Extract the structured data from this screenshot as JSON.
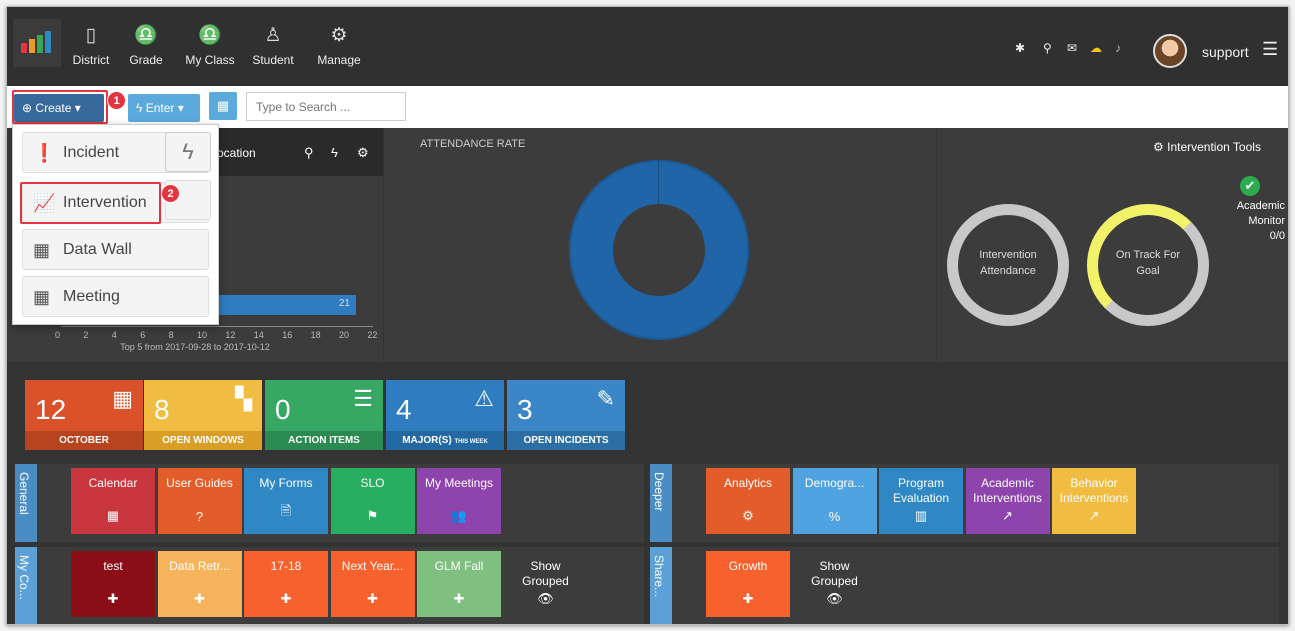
{
  "nav": {
    "items": [
      {
        "label": "District",
        "icon": "building-icon",
        "glyph": "▯"
      },
      {
        "label": "Grade",
        "icon": "users-icon",
        "glyph": "♎"
      },
      {
        "label": "My Class",
        "icon": "users-icon",
        "glyph": "♎"
      },
      {
        "label": "Student",
        "icon": "user-icon",
        "glyph": "♙"
      },
      {
        "label": "Manage",
        "icon": "gears-icon",
        "glyph": "⚙"
      }
    ],
    "user": "support"
  },
  "toolbar": {
    "create_label": "Create",
    "enter_label": "Enter",
    "search_placeholder": "Type to Search ..."
  },
  "dropdown": {
    "items": [
      "Incident",
      "Intervention",
      "Data Wall",
      "Meeting"
    ]
  },
  "callouts": {
    "one": "1",
    "two": "2"
  },
  "widgets": {
    "incidents_header": "ocation",
    "bar_value": "21",
    "x_ticks": [
      "0",
      "2",
      "4",
      "6",
      "8",
      "10",
      "12",
      "14",
      "16",
      "18",
      "20",
      "22"
    ],
    "footnote": "Top 5 from 2017-09-28 to 2017-10-12",
    "attendance_title": "ATTENDANCE RATE",
    "intervention_tools": "Intervention Tools",
    "ring1": "Intervention Attendance",
    "ring2": "On Track For Goal",
    "academic": "Academic Monitor",
    "academic_count": "0/0"
  },
  "tiles": [
    {
      "num": "12",
      "label": "OCTOBER",
      "color": "#d9522a",
      "dark": "#b8431f",
      "icon": "calendar-icon",
      "glyph": "▦"
    },
    {
      "num": "8",
      "label": "OPEN WINDOWS",
      "color": "#f0bc41",
      "dark": "#d99e25",
      "icon": "windows-icon",
      "glyph": "▚"
    },
    {
      "num": "0",
      "label": "ACTION ITEMS",
      "color": "#37a764",
      "dark": "#2a8a4f",
      "icon": "list-icon",
      "glyph": "☰"
    },
    {
      "num": "4",
      "label": "MAJOR(S)",
      "sub": "THIS WEEK",
      "color": "#2f7cc0",
      "dark": "#2468a3",
      "icon": "warning-icon",
      "glyph": "⚠"
    },
    {
      "num": "3",
      "label": "OPEN INCIDENTS",
      "color": "#3a86c6",
      "dark": "#2c6fa6",
      "icon": "pencil-icon",
      "glyph": "✎"
    }
  ],
  "sections": {
    "general": {
      "tab": "General",
      "cards": [
        {
          "label": "Calendar",
          "color": "#c9363e",
          "glyph": "▦",
          "icon": "calendar-icon"
        },
        {
          "label": "User Guides",
          "color": "#e35d2a",
          "glyph": "?",
          "icon": "question-icon"
        },
        {
          "label": "My Forms",
          "color": "#2f87c4",
          "glyph": "🗎",
          "icon": "form-icon"
        },
        {
          "label": "SLO",
          "color": "#27ae60",
          "glyph": "⚑",
          "icon": "flag-icon"
        },
        {
          "label": "My Meetings",
          "color": "#8e44ad",
          "glyph": "👥",
          "icon": "group-icon"
        }
      ]
    },
    "deeper": {
      "tab": "Deeper",
      "cards": [
        {
          "label": "Analytics",
          "color": "#e35d2a",
          "glyph": "⚙",
          "icon": "gears-icon"
        },
        {
          "label": "Demogra...",
          "color": "#4fa3e0",
          "glyph": "%",
          "icon": "percent-icon"
        },
        {
          "label": "Program Evaluation",
          "color": "#2f87c4",
          "glyph": "▥",
          "icon": "chart-icon"
        },
        {
          "label": "Academic Interventions",
          "color": "#8e44ad",
          "glyph": "↗",
          "icon": "trend-icon"
        },
        {
          "label": "Behavior Interventions",
          "color": "#f0bc41",
          "glyph": "↗",
          "icon": "trend-icon"
        }
      ]
    },
    "mycollections": {
      "tab": "My Co...",
      "cards": [
        {
          "label": "test",
          "color": "#8b0d18",
          "glyph": "✚",
          "icon": "puzzle-icon"
        },
        {
          "label": "Data Retr...",
          "color": "#f5b45c",
          "glyph": "✚",
          "icon": "puzzle-icon"
        },
        {
          "label": "17-18",
          "color": "#f7612d",
          "glyph": "✚",
          "icon": "puzzle-icon"
        },
        {
          "label": "Next Year...",
          "color": "#f7612d",
          "glyph": "✚",
          "icon": "puzzle-icon"
        },
        {
          "label": "GLM Fall",
          "color": "#7fbf7f",
          "glyph": "✚",
          "icon": "puzzle-icon"
        }
      ],
      "show": "Show Grouped"
    },
    "shared": {
      "tab": "Share...",
      "cards": [
        {
          "label": "Growth",
          "color": "#f7612d",
          "glyph": "✚",
          "icon": "puzzle-icon"
        }
      ],
      "show": "Show Grouped"
    }
  }
}
